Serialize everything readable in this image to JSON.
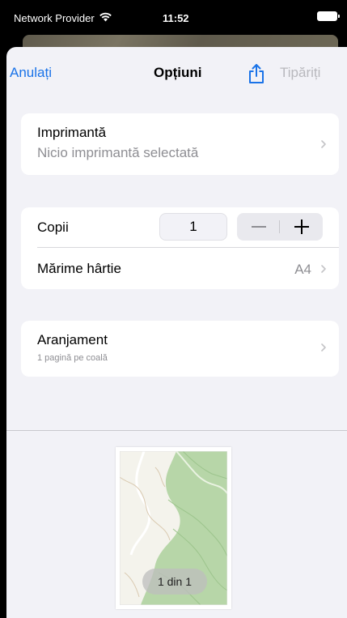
{
  "status_bar": {
    "carrier": "Network Provider",
    "time": "11:52",
    "wifi_icon": "wifi-icon",
    "battery_icon": "battery-icon"
  },
  "nav": {
    "cancel_label": "Anulați",
    "title": "Opțiuni",
    "share_icon": "share-icon",
    "print_label": "Tipăriți",
    "accent_color": "#1a73e8",
    "disabled_color": "#b8b8bd"
  },
  "printer": {
    "title": "Imprimantă",
    "value": "Nicio imprimantă selectată"
  },
  "copies": {
    "label": "Copii",
    "count": "1",
    "minus": "—",
    "plus": "+"
  },
  "paper_size": {
    "label": "Mărime hârtie",
    "value": "A4"
  },
  "layout": {
    "title": "Aranjament",
    "value": "1 pagină pe coală"
  },
  "preview": {
    "page_label": "1 din 1"
  }
}
